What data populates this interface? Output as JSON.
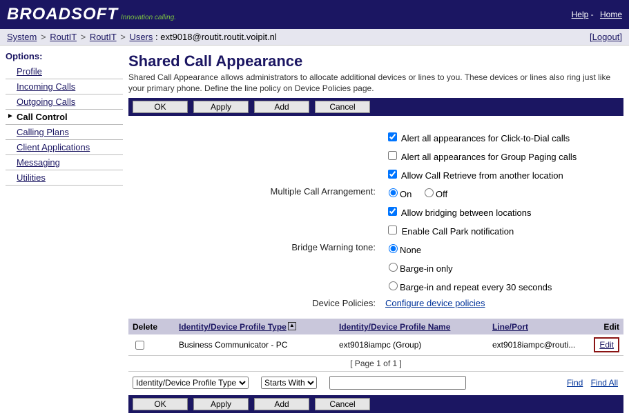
{
  "top": {
    "brand": "BROADSOFT",
    "tagline": "Innovation calling.",
    "help": "Help",
    "home": "Home"
  },
  "breadcrumb": {
    "items": [
      "System",
      "RoutIT",
      "RoutIT",
      "Users"
    ],
    "suffix": ": ext9018@routit.routit.voipit.nl",
    "logout": "[Logout]"
  },
  "sidebar": {
    "heading": "Options:",
    "items": [
      {
        "label": "Profile",
        "active": false
      },
      {
        "label": "Incoming Calls",
        "active": false
      },
      {
        "label": "Outgoing Calls",
        "active": false
      },
      {
        "label": "Call Control",
        "active": true
      },
      {
        "label": "Calling Plans",
        "active": false
      },
      {
        "label": "Client Applications",
        "active": false
      },
      {
        "label": "Messaging",
        "active": false
      },
      {
        "label": "Utilities",
        "active": false
      }
    ]
  },
  "page": {
    "title": "Shared Call Appearance",
    "desc": "Shared Call Appearance allows administrators to allocate additional devices or lines to you. These devices or lines also ring just like your primary phone. Define the line policy on Device Policies page."
  },
  "buttons": {
    "ok": "OK",
    "apply": "Apply",
    "add": "Add",
    "cancel": "Cancel"
  },
  "settings": {
    "alert_click_to_dial": {
      "label": "Alert all appearances for Click-to-Dial calls",
      "checked": true
    },
    "alert_group_paging": {
      "label": "Alert all appearances for Group Paging calls",
      "checked": false
    },
    "allow_call_retrieve": {
      "label": "Allow Call Retrieve from another location",
      "checked": true
    },
    "multiple_call_label": "Multiple Call Arrangement:",
    "multiple_call_on": "On",
    "multiple_call_off": "Off",
    "multiple_call_value": "on",
    "allow_bridging": {
      "label": "Allow bridging between locations",
      "checked": true
    },
    "enable_call_park": {
      "label": "Enable Call Park notification",
      "checked": false
    },
    "bridge_warning_label": "Bridge Warning tone:",
    "bridge_none": "None",
    "bridge_barge_in": "Barge-in only",
    "bridge_barge_repeat": "Barge-in and repeat every 30 seconds",
    "bridge_value": "none",
    "device_policies_label": "Device Policies:",
    "device_policies_link": "Configure device policies"
  },
  "table": {
    "headers": {
      "delete": "Delete",
      "type": "Identity/Device Profile Type",
      "name": "Identity/Device Profile Name",
      "lineport": "Line/Port",
      "edit": "Edit"
    },
    "rows": [
      {
        "type": "Business Communicator - PC",
        "name": "ext9018iampc (Group)",
        "lineport": "ext9018iampc@routi...",
        "edit": "Edit"
      }
    ],
    "paginator": "[ Page 1 of 1 ]"
  },
  "search": {
    "field_options": [
      "Identity/Device Profile Type"
    ],
    "match_options": [
      "Starts With"
    ],
    "find": "Find",
    "find_all": "Find All"
  }
}
